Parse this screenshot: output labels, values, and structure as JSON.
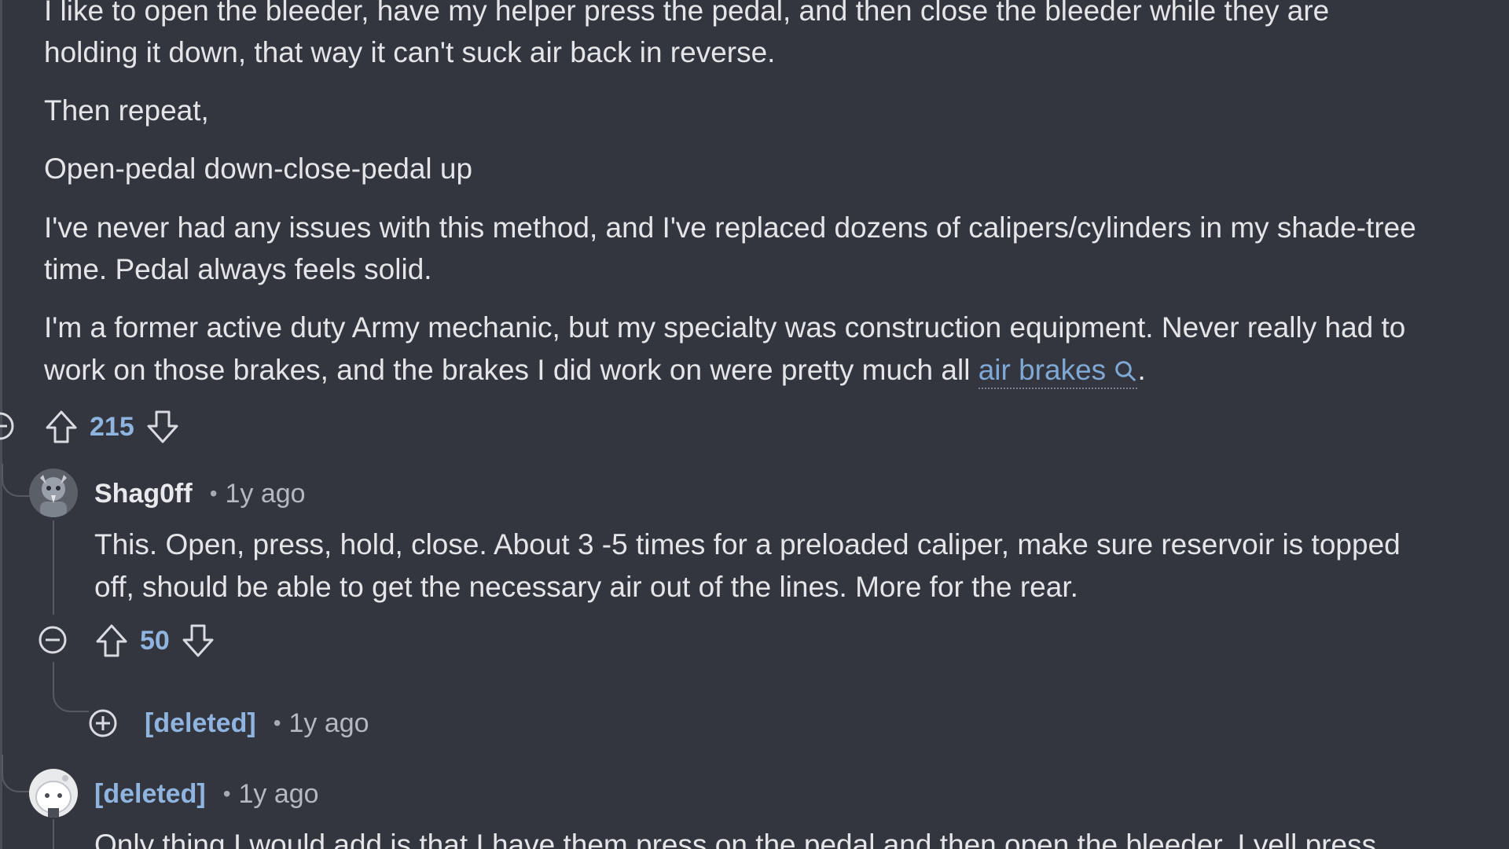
{
  "parent_comment": {
    "lines": [
      "I like to open the bleeder, have my helper press the pedal, and then close the bleeder while they are",
      "holding it down, that way it can't suck air back in reverse.",
      "Then repeat,",
      "Open-pedal down-close-pedal up",
      "I've never had any issues with this method, and I've replaced dozens of calipers/cylinders in my shade-tree",
      "time. Pedal always feels solid.",
      "I'm a former active duty Army mechanic, but my specialty was construction equipment. Never really had to"
    ],
    "last_line_prefix": "work on those brakes, and the brakes I did work on were pretty much all ",
    "link_text": "air brakes",
    "last_line_suffix": ".",
    "score": "215"
  },
  "reply_1": {
    "author": "Shag0ff",
    "separator": "•",
    "time": "1y ago",
    "lines": [
      "This. Open, press, hold, close. About 3 -5 times for a preloaded caliper, make sure reservoir is topped",
      "off, should be able to get the necessary air out of the lines. More for the rear."
    ],
    "score": "50"
  },
  "reply_1_child": {
    "author": "[deleted]",
    "separator": "•",
    "time": "1y ago"
  },
  "reply_2": {
    "author": "[deleted]",
    "separator": "•",
    "time": "1y ago",
    "line": "Only thing I would add is that I have them press on the pedal and then open the bleeder. I yell press"
  },
  "icons": {
    "upvote": "arrow-up-outline-icon",
    "downvote": "arrow-down-outline-icon",
    "collapse": "minus-circle-icon",
    "expand": "plus-circle-icon",
    "search": "search-icon"
  },
  "colors": {
    "background": "#33363e",
    "text": "#e4e5e8",
    "link": "#7fa8d4",
    "score": "#8fb4e0",
    "muted": "#b5b8bf"
  }
}
